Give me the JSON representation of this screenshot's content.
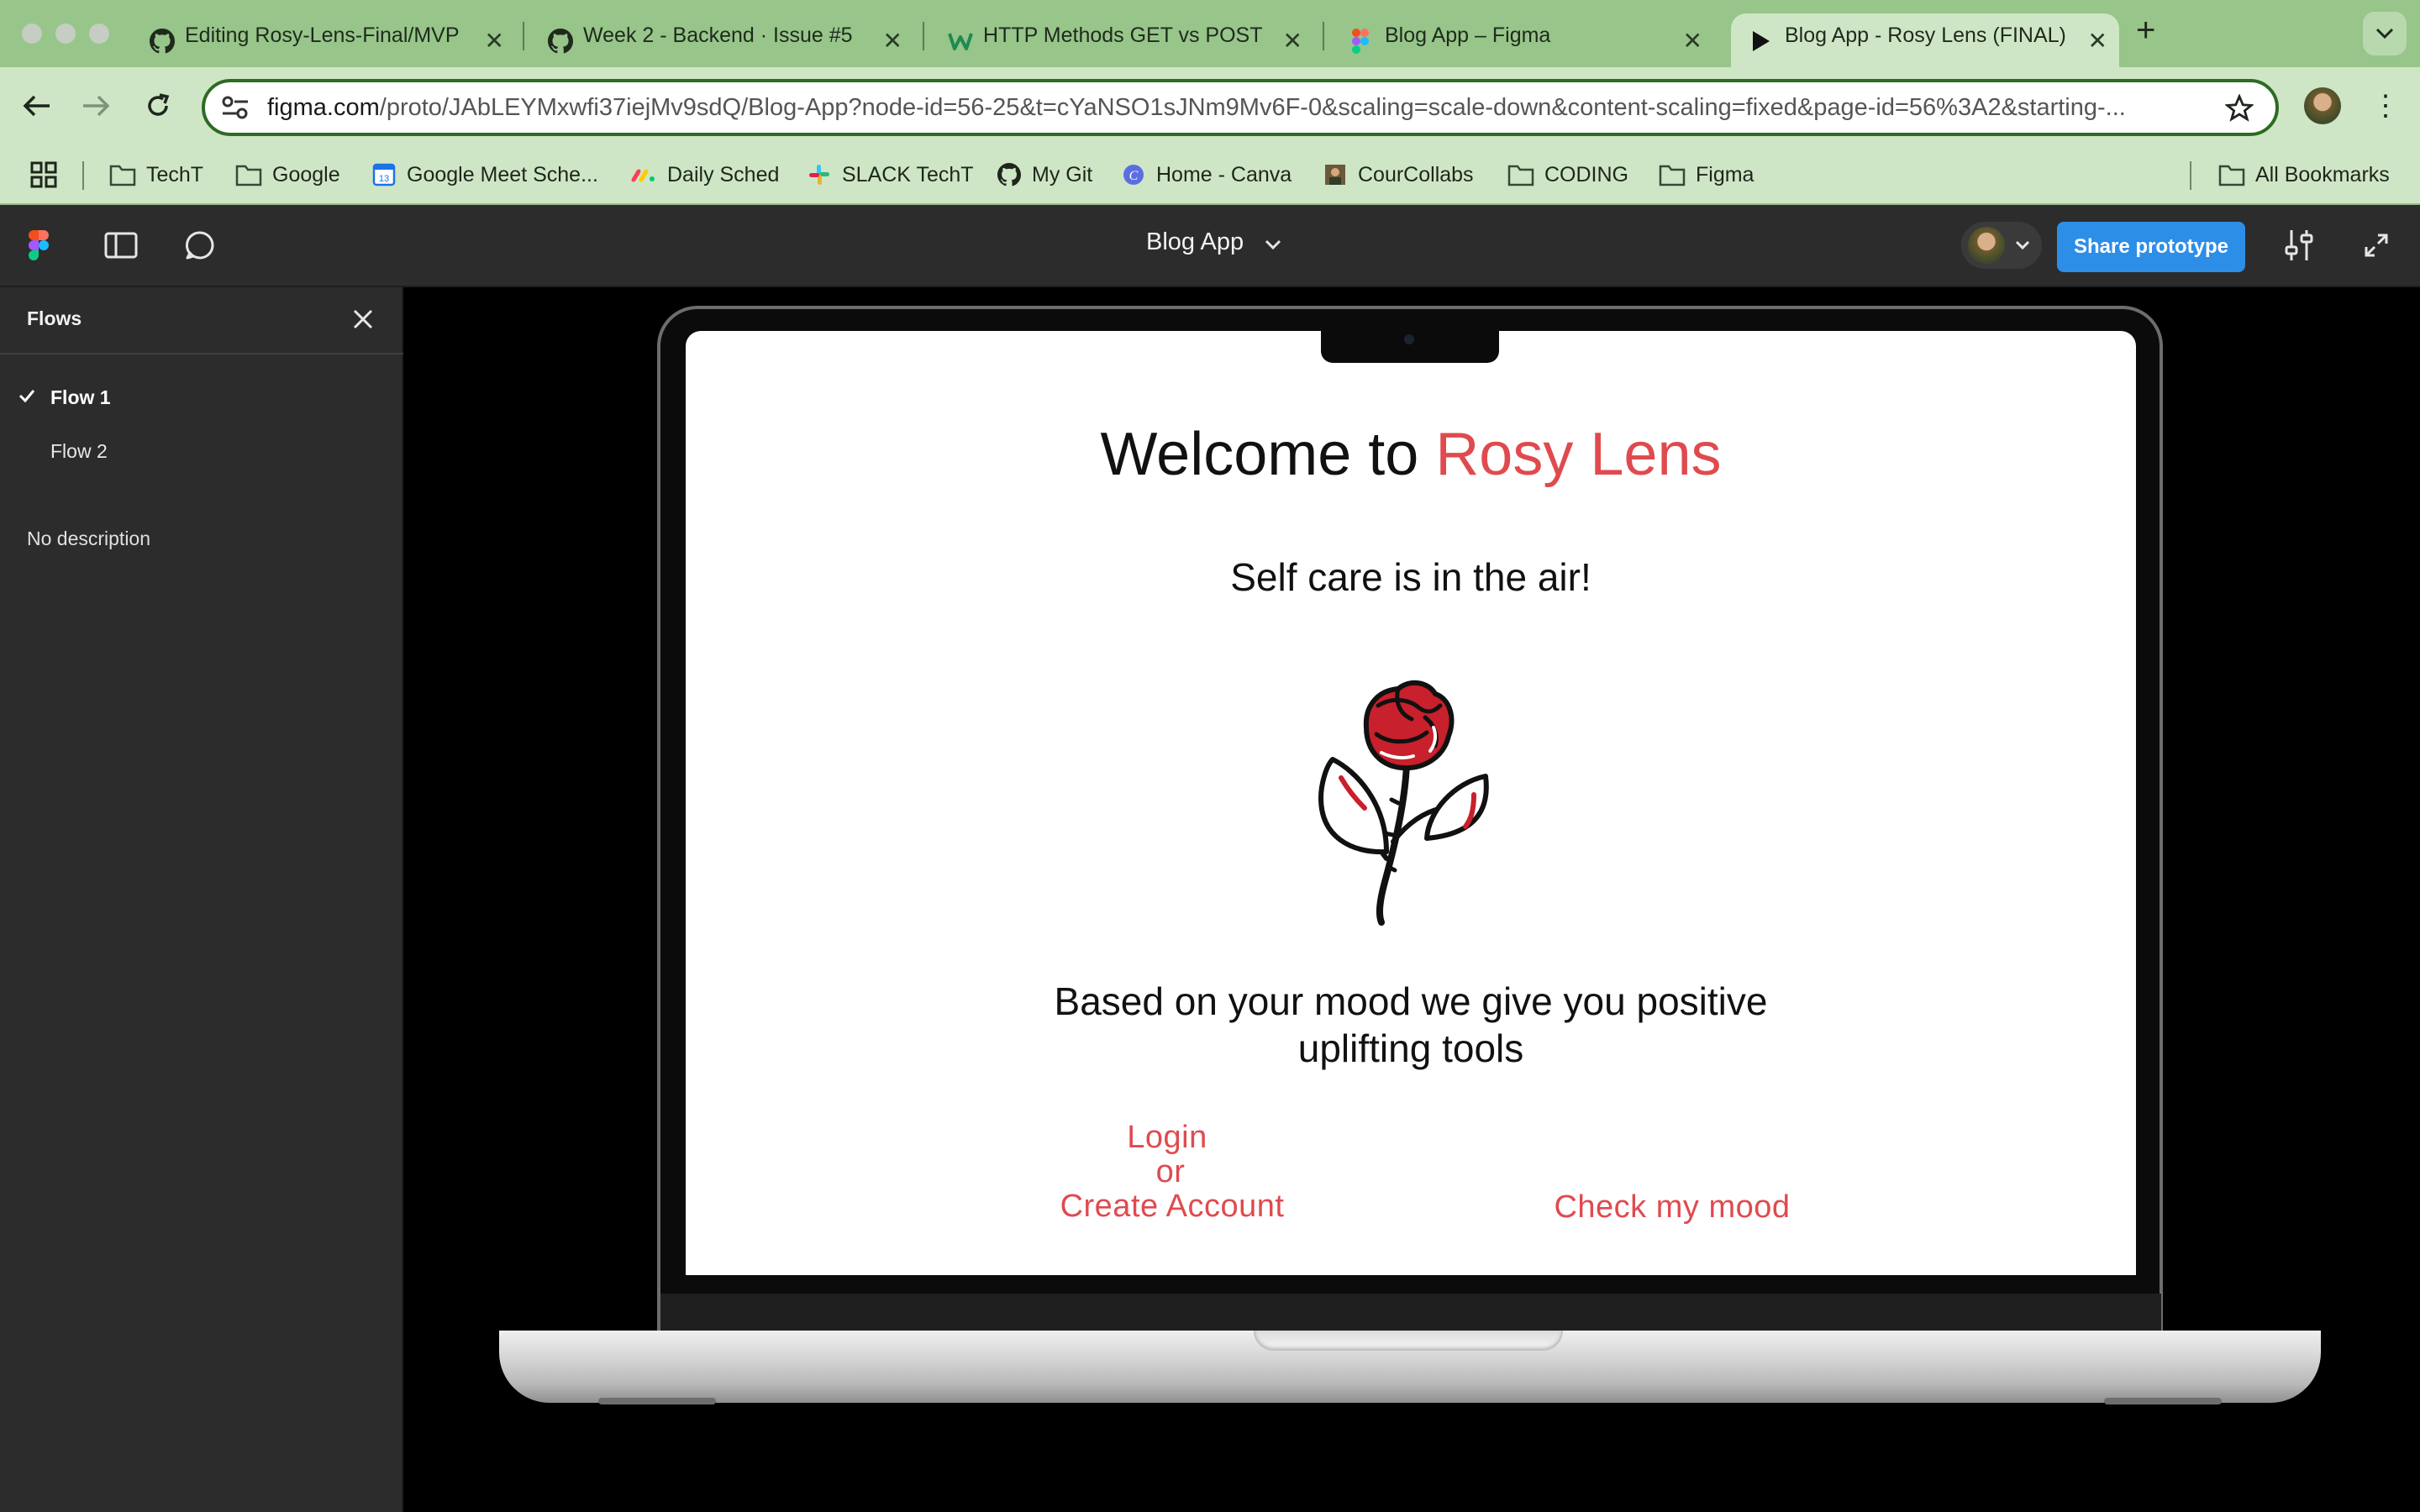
{
  "browser": {
    "tabs": [
      {
        "title": "Editing Rosy-Lens-Final/MVP",
        "icon": "github-icon"
      },
      {
        "title": "Week 2 - Backend · Issue #5",
        "icon": "github-icon"
      },
      {
        "title": "HTTP Methods GET vs POST",
        "icon": "w-logo-icon"
      },
      {
        "title": "Blog App – Figma",
        "icon": "figma-icon"
      },
      {
        "title": "Blog App - Rosy Lens (FINAL)",
        "icon": "play-icon",
        "active": true
      }
    ],
    "url_domain": "figma.com",
    "url_path": "/proto/JAbLEYMxwfi37iejMv9sdQ/Blog-App?node-id=56-25&t=cYaNSO1sJNm9Mv6F-0&scaling=scale-down&content-scaling=fixed&page-id=56%3A2&starting-...",
    "bookmarks": [
      {
        "label": "TechT",
        "icon": "folder-icon"
      },
      {
        "label": "Google",
        "icon": "folder-icon"
      },
      {
        "label": "Google Meet Sche...",
        "icon": "calendar-icon"
      },
      {
        "label": "Daily Sched",
        "icon": "monday-icon"
      },
      {
        "label": "SLACK TechT",
        "icon": "slack-icon"
      },
      {
        "label": "My Git",
        "icon": "github-icon"
      },
      {
        "label": "Home - Canva",
        "icon": "canva-icon"
      },
      {
        "label": "CourCollabs",
        "icon": "avatar-icon"
      },
      {
        "label": "CODING",
        "icon": "folder-icon"
      },
      {
        "label": "Figma",
        "icon": "folder-icon"
      }
    ],
    "all_bookmarks": "All Bookmarks"
  },
  "figma": {
    "file_name": "Blog App",
    "share_button": "Share prototype"
  },
  "sidebar": {
    "title": "Flows",
    "flows": [
      {
        "label": "Flow 1",
        "selected": true
      },
      {
        "label": "Flow 2",
        "selected": false
      }
    ],
    "description": "No description"
  },
  "prototype": {
    "welcome_prefix": "Welcome to ",
    "brand": "Rosy Lens",
    "tagline": "Self care is in the air!",
    "body_line1": "Based on your mood we give you positive",
    "body_line2": "uplifting tools",
    "login_line1": "Login",
    "login_line2": "or",
    "login_line3": "Create Account",
    "mood_link": "Check my mood"
  },
  "colors": {
    "accent": "#e04a4f",
    "chrome_tab": "#97c58a",
    "chrome_toolbar": "#cfe6c6",
    "figma_dark": "#2c2c2c",
    "share_blue": "#0d99ff"
  }
}
